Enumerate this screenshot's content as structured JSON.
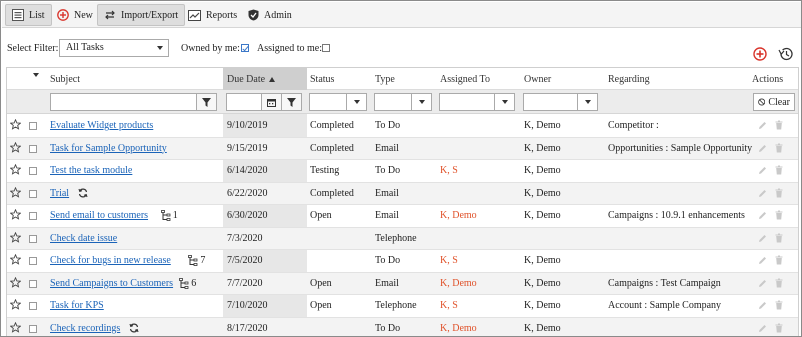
{
  "toolbar": {
    "list": "List",
    "new": "New",
    "import_export": "Import/Export",
    "reports": "Reports",
    "admin": "Admin"
  },
  "filters": {
    "select_label": "Select Filter:",
    "select_value": "All Tasks",
    "owned_label": "Owned by me:",
    "owned_checked": true,
    "assigned_label": "Assigned to me:",
    "assigned_checked": false
  },
  "columns": {
    "subject": "Subject",
    "due_date": "Due Date",
    "status": "Status",
    "type": "Type",
    "assigned_to": "Assigned To",
    "owner": "Owner",
    "regarding": "Regarding",
    "actions": "Actions"
  },
  "clear_label": "Clear",
  "rows": [
    {
      "subject": "Evaluate Widget products",
      "due": "9/10/2019",
      "status": "Completed",
      "type": "To Do",
      "assigned": "",
      "owner": "K, Demo",
      "regarding": "Competitor :",
      "extra": ""
    },
    {
      "subject": "Task for Sample Opportunity",
      "due": "9/15/2019",
      "status": "Completed",
      "type": "Email",
      "assigned": "",
      "owner": "K, Demo",
      "regarding": "Opportunities : Sample Opportunity",
      "extra": ""
    },
    {
      "subject": "Test the task module",
      "due": "6/14/2020",
      "status": "Testing",
      "type": "To Do",
      "assigned": "K, S",
      "owner": "K, Demo",
      "regarding": "",
      "extra": ""
    },
    {
      "subject": "Trial",
      "due": "6/22/2020",
      "status": "Completed",
      "type": "Email",
      "assigned": "",
      "owner": "K, Demo",
      "regarding": "",
      "extra": "recur"
    },
    {
      "subject": "Send email to customers",
      "due": "6/30/2020",
      "status": "Open",
      "type": "Email",
      "assigned": "K, Demo",
      "owner": "K, Demo",
      "regarding": "Campaigns : 10.9.1 enhancements",
      "extra": "sub",
      "count": "1"
    },
    {
      "subject": "Check date issue",
      "due": "7/3/2020",
      "status": "",
      "type": "Telephone",
      "assigned": "",
      "owner": "",
      "regarding": "",
      "extra": ""
    },
    {
      "subject": "Check for bugs in new release",
      "due": "7/5/2020",
      "status": "",
      "type": "To Do",
      "assigned": "K, S",
      "owner": "K, Demo",
      "regarding": "",
      "extra": "sub",
      "count": "7"
    },
    {
      "subject": "Send Campaigns to Customers",
      "due": "7/7/2020",
      "status": "Open",
      "type": "Email",
      "assigned": "K, Demo",
      "owner": "K, Demo",
      "regarding": "Campaigns : Test Campaign",
      "extra": "sub",
      "count": "6"
    },
    {
      "subject": "Task for KPS",
      "due": "7/10/2020",
      "status": "Open",
      "type": "Telephone",
      "assigned": "K, S",
      "owner": "K, Demo",
      "regarding": "Account : Sample Company",
      "extra": ""
    },
    {
      "subject": "Check recordings",
      "due": "8/17/2020",
      "status": "",
      "type": "To Do",
      "assigned": "K, Demo",
      "owner": "K, Demo",
      "regarding": "",
      "extra": "recur"
    }
  ],
  "colors": {
    "link": "#1a63b8",
    "assigned": "#e0522a",
    "add_icon": "#d9342b"
  }
}
